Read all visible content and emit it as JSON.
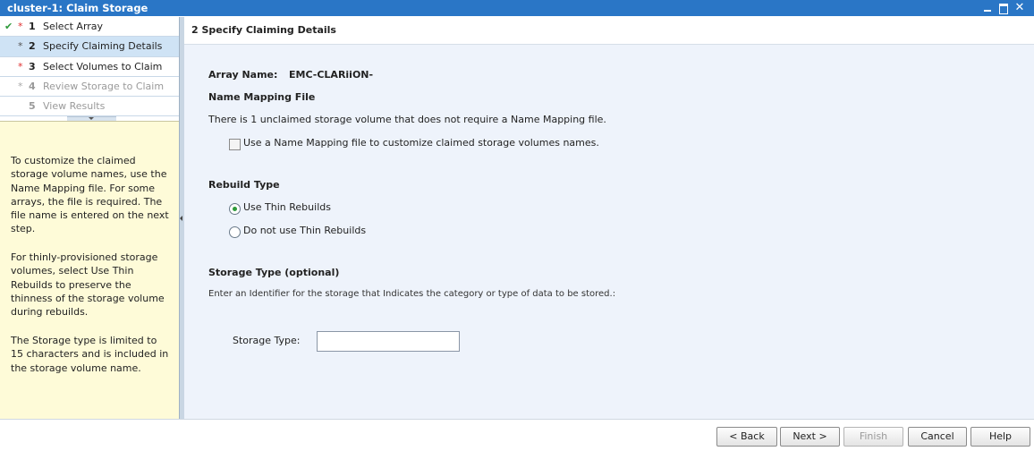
{
  "window": {
    "title": "cluster-1: Claim Storage"
  },
  "steps": [
    {
      "num": "1",
      "label": "Select Array"
    },
    {
      "num": "2",
      "label": "Specify Claiming Details"
    },
    {
      "num": "3",
      "label": "Select Volumes to Claim"
    },
    {
      "num": "4",
      "label": "Review Storage to Claim"
    },
    {
      "num": "5",
      "label": "View Results"
    }
  ],
  "help": {
    "para1": "To customize the claimed storage volume names, use the Name Mapping file. For some arrays, the file is required. The file name is entered on the next step.",
    "para2": "For thinly-provisioned storage volumes, select Use Thin Rebuilds to preserve the thinness of the storage volume during rebuilds.",
    "para3": "The Storage type is limited to 15 characters and is included in the storage volume name."
  },
  "content": {
    "header": "2  Specify Claiming Details",
    "array_label": "Array Name:",
    "array_value": "EMC-CLARiiON-",
    "mapping_heading": "Name Mapping File",
    "mapping_text": "There is 1 unclaimed storage volume that does not require a Name Mapping file.",
    "mapping_checkbox_label": "Use a Name Mapping file to customize claimed storage volumes names.",
    "rebuild_heading": "Rebuild Type",
    "rebuild_option_1": "Use Thin Rebuilds",
    "rebuild_option_2": "Do not use Thin Rebuilds",
    "storage_heading": "Storage Type (optional)",
    "storage_hint": "Enter an Identifier for the storage that Indicates the category or type of data to be stored.:",
    "storage_field_label": "Storage Type:",
    "storage_field_value": ""
  },
  "footer": {
    "back": "< Back",
    "next": "Next >",
    "finish": "Finish",
    "cancel": "Cancel",
    "help": "Help"
  }
}
